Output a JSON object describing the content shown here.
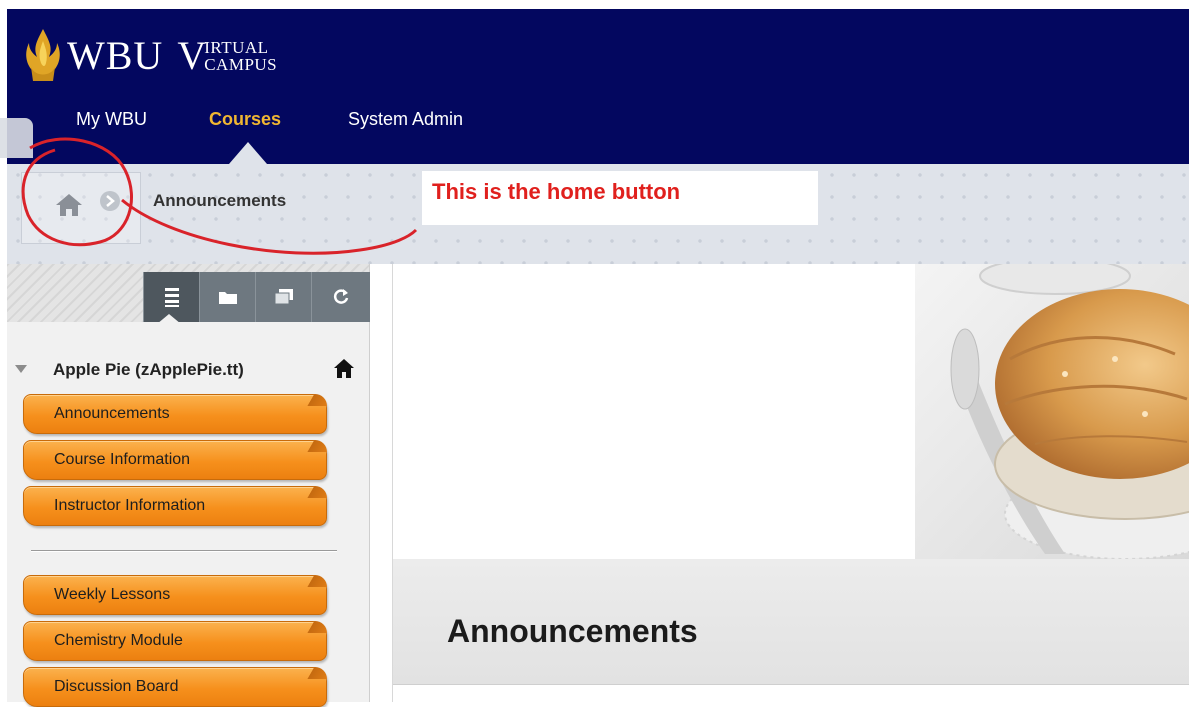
{
  "header": {
    "logo_wbu": "WBU",
    "logo_v": "V",
    "logo_virtual": "IRTUAL",
    "logo_campus": "CAMPUS",
    "nav": [
      "My WBU",
      "Courses",
      "System Admin"
    ],
    "active_nav": "Courses",
    "bg_color": "#03075f",
    "active_color": "#f0b632"
  },
  "breadcrumb": {
    "home_icon": "home-icon",
    "separator_icon": "chevron-right-icon",
    "current": "Announcements"
  },
  "annotation": {
    "text": "This is the home button",
    "color": "#e0201d"
  },
  "sidebar": {
    "toolbar_icons": [
      "list-view-icon",
      "folder-view-icon",
      "window-icon",
      "refresh-icon"
    ],
    "course_title": "Apple Pie (zApplePie.tt)",
    "course_home_icon": "home-icon",
    "menu_group_1": [
      "Announcements",
      "Course Information",
      "Instructor Information"
    ],
    "menu_group_2": [
      "Weekly Lessons",
      "Chemistry Module",
      "Discussion Board"
    ],
    "menu_color": "#f6901c"
  },
  "content": {
    "banner_image": "apple-pie-image",
    "title": "Announcements"
  }
}
